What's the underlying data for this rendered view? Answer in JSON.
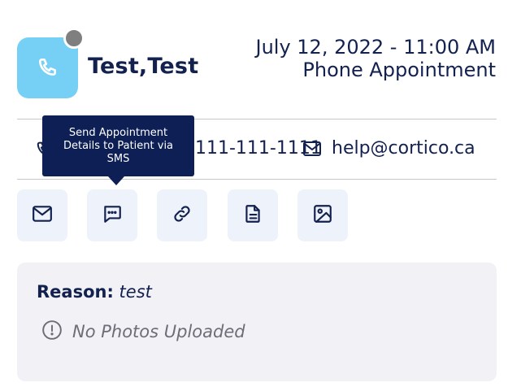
{
  "patient": {
    "name": "Test,Test",
    "status_color": "#7f7f7f",
    "avatar_color": "#76d0f5",
    "avatar_icon": "phone-icon"
  },
  "appointment": {
    "date_time": "July 12, 2022 - 11:00 AM",
    "type": "Phone Appointment"
  },
  "contact": {
    "phone": "111-111-1111",
    "email": "help@cortico.ca",
    "phone_icon": "phone-icon",
    "email_icon": "mail-icon"
  },
  "tooltip": {
    "lines": [
      "Send Appointment",
      "Details to Patient via",
      "SMS"
    ]
  },
  "actions": [
    {
      "icon": "mail-icon"
    },
    {
      "icon": "message-icon"
    },
    {
      "icon": "link-icon"
    },
    {
      "icon": "document-icon"
    },
    {
      "icon": "image-icon"
    }
  ],
  "reason": {
    "label": "Reason:",
    "value": "test",
    "photos_text": "No Photos Uploaded",
    "photos_icon": "alert-circle-icon"
  },
  "colors": {
    "primary_text": "#13214f",
    "tooltip_bg": "#0d1f55",
    "action_bg": "#eef3fb",
    "card_bg": "#f1f1f6",
    "muted": "#6d6d78"
  }
}
